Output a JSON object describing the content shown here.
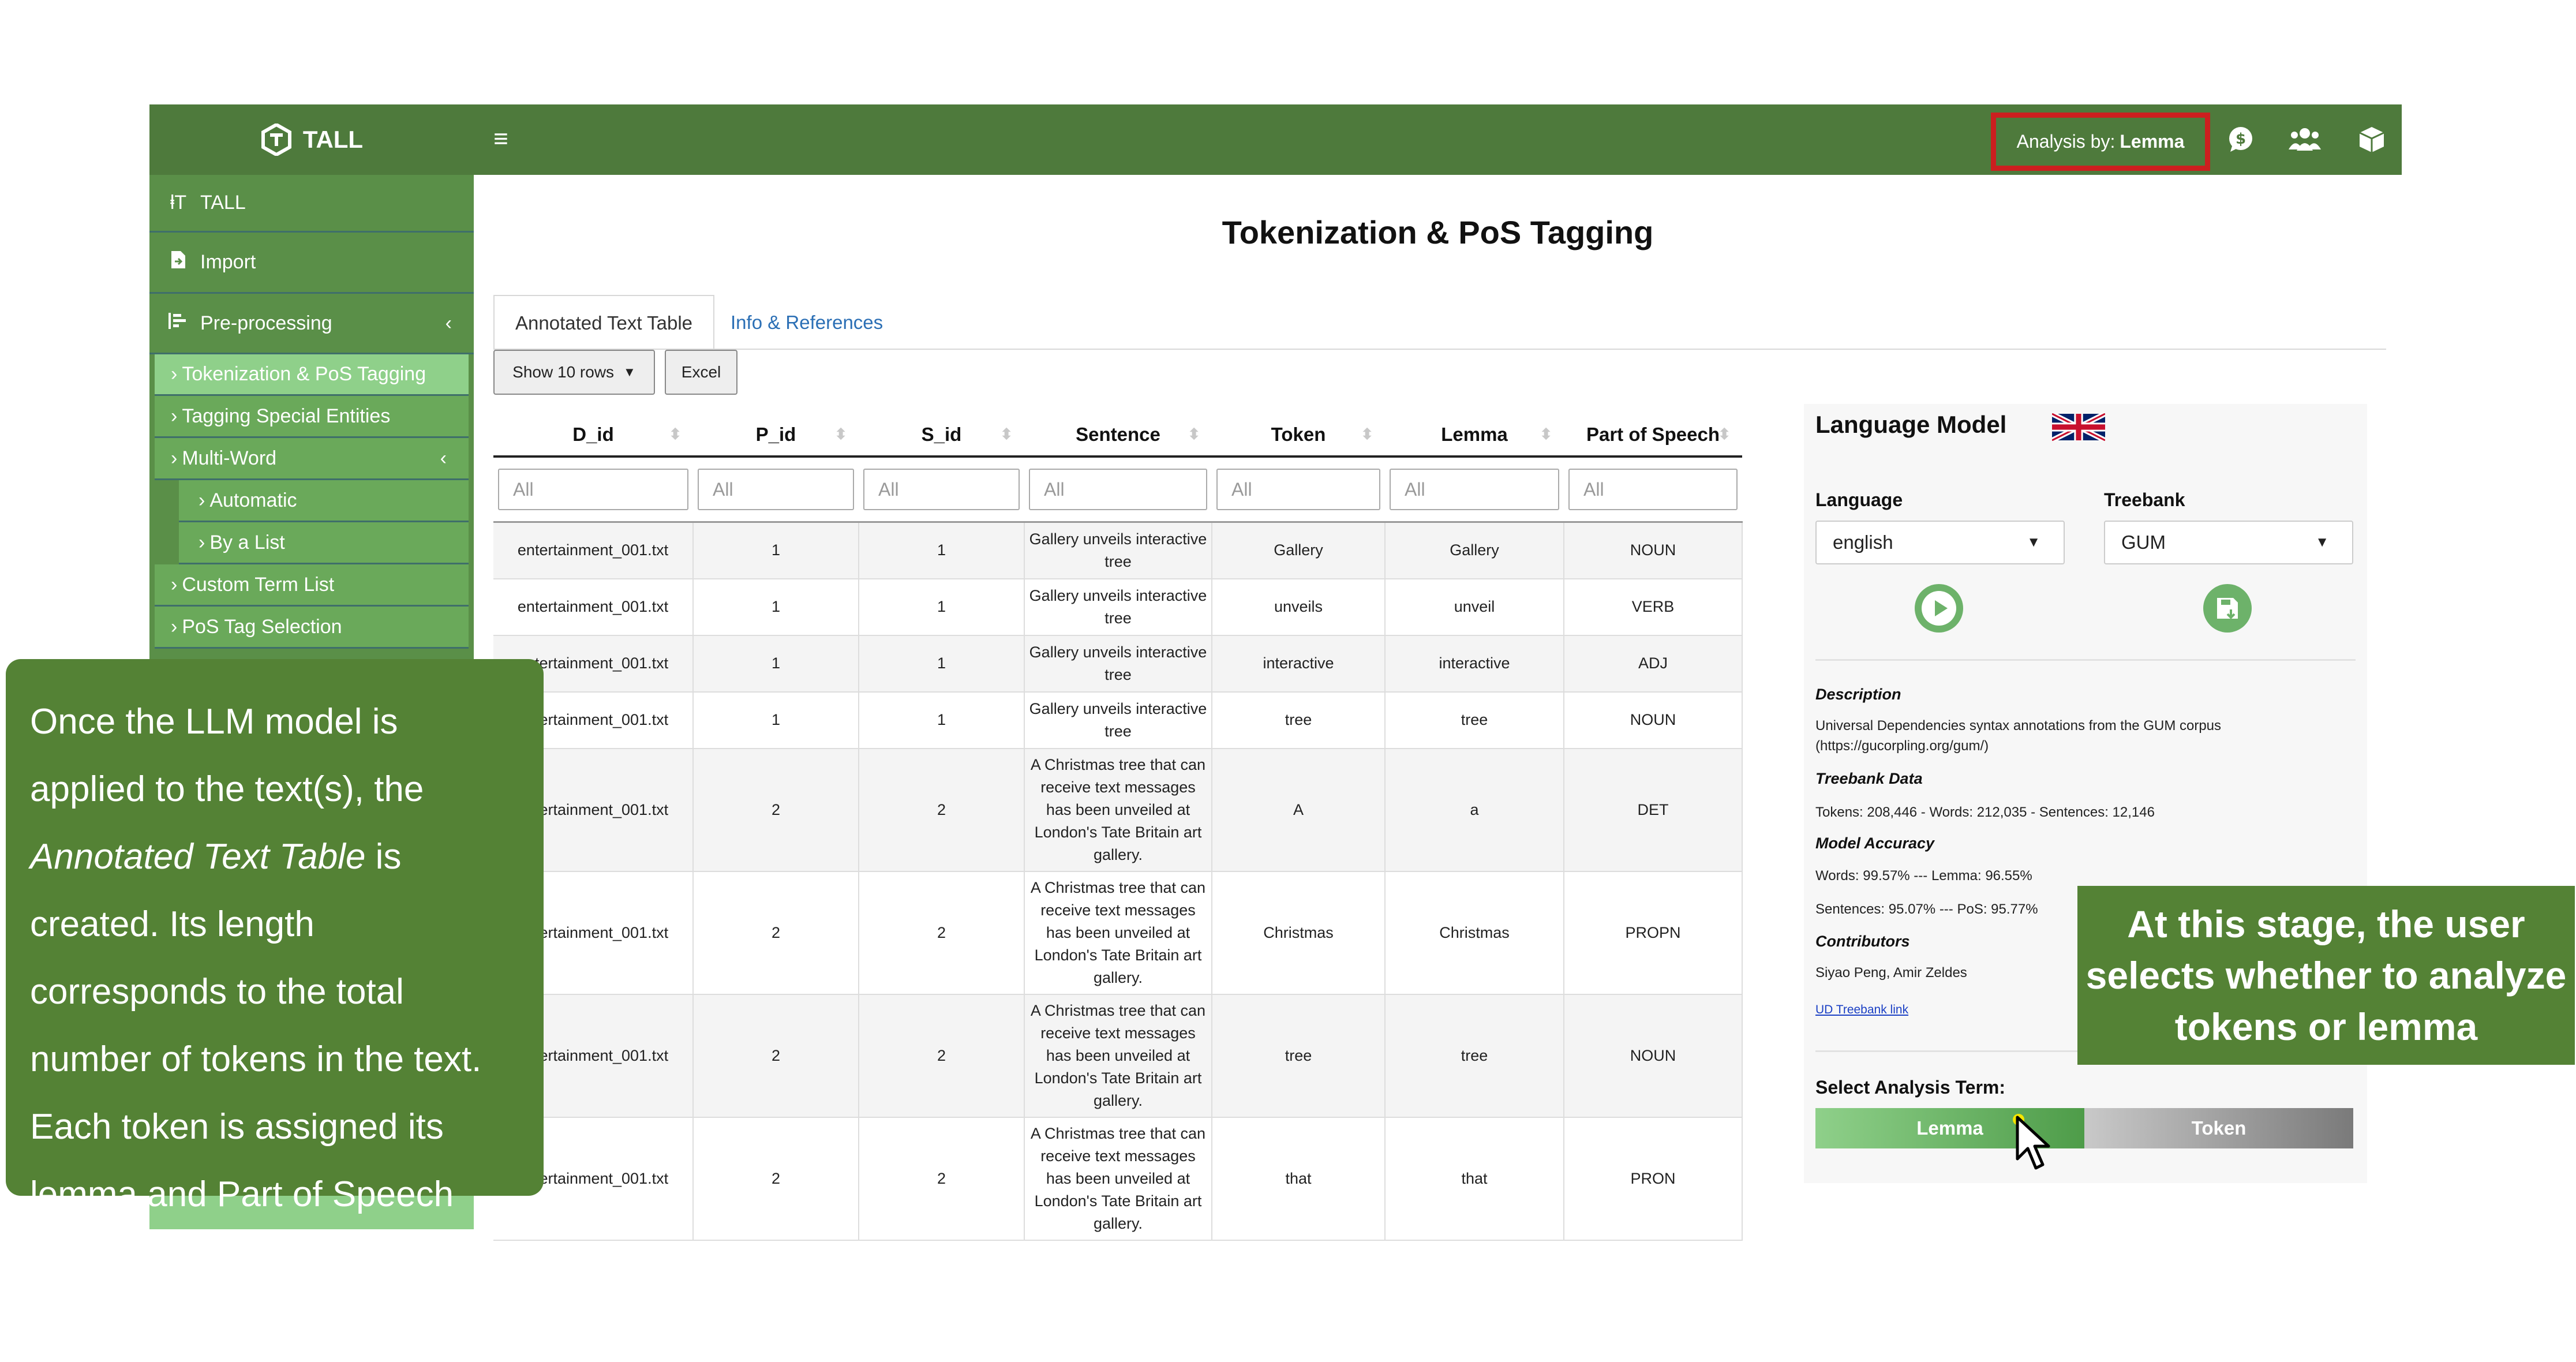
{
  "app": {
    "brand": "TALL",
    "analysis_label": "Analysis by:",
    "analysis_value": "Lemma"
  },
  "sidebar": {
    "items": [
      {
        "label": "TALL",
        "icon": "text-height-icon"
      },
      {
        "label": "Import",
        "icon": "file-import-icon"
      },
      {
        "label": "Pre-processing",
        "icon": "bars-staggered-icon"
      }
    ],
    "sub_items": [
      {
        "label": "Tokenization & PoS Tagging",
        "active": true
      },
      {
        "label": "Tagging Special Entities"
      },
      {
        "label": "Multi-Word"
      },
      {
        "label": "Automatic"
      },
      {
        "label": "By a List"
      },
      {
        "label": "Custom Term List"
      },
      {
        "label": "PoS Tag Selection"
      }
    ]
  },
  "main": {
    "title": "Tokenization & PoS Tagging",
    "tabs": [
      "Annotated Text Table",
      "Info & References"
    ],
    "show_rows": "Show 10 rows",
    "excel": "Excel",
    "filter_placeholder": "All",
    "columns": [
      "D_id",
      "P_id",
      "S_id",
      "Sentence",
      "Token",
      "Lemma",
      "Part of Speech"
    ],
    "rows": [
      [
        "entertainment_001.txt",
        "1",
        "1",
        "Gallery unveils interactive tree",
        "Gallery",
        "Gallery",
        "NOUN"
      ],
      [
        "entertainment_001.txt",
        "1",
        "1",
        "Gallery unveils interactive tree",
        "unveils",
        "unveil",
        "VERB"
      ],
      [
        "entertainment_001.txt",
        "1",
        "1",
        "Gallery unveils interactive tree",
        "interactive",
        "interactive",
        "ADJ"
      ],
      [
        "entertainment_001.txt",
        "1",
        "1",
        "Gallery unveils interactive tree",
        "tree",
        "tree",
        "NOUN"
      ],
      [
        "entertainment_001.txt",
        "2",
        "2",
        "A Christmas tree that can receive text messages has been unveiled at London's Tate Britain art gallery.",
        "A",
        "a",
        "DET"
      ],
      [
        "entertainment_001.txt",
        "2",
        "2",
        "A Christmas tree that can receive text messages has been unveiled at London's Tate Britain art gallery.",
        "Christmas",
        "Christmas",
        "PROPN"
      ],
      [
        "entertainment_001.txt",
        "2",
        "2",
        "A Christmas tree that can receive text messages has been unveiled at London's Tate Britain art gallery.",
        "tree",
        "tree",
        "NOUN"
      ],
      [
        "entertainment_001.txt",
        "2",
        "2",
        "A Christmas tree that can receive text messages has been unveiled at London's Tate Britain art gallery.",
        "that",
        "that",
        "PRON"
      ]
    ]
  },
  "language_model": {
    "title": "Language Model",
    "language_label": "Language",
    "language_value": "english",
    "treebank_label": "Treebank",
    "treebank_value": "GUM",
    "description_title": "Description",
    "description_text": "Universal Dependencies syntax annotations from the GUM corpus",
    "description_url": "(https://gucorpling.org/gum/)",
    "treebank_data_title": "Treebank Data",
    "treebank_data": "Tokens: 208,446 - Words: 212,035 - Sentences: 12,146",
    "accuracy_title": "Model Accuracy",
    "accuracy_1": "Words: 99.57% --- Lemma: 96.55%",
    "accuracy_2": "Sentences: 95.07% --- PoS: 95.77%",
    "contributors_title": "Contributors",
    "contributors": "Siyao Peng, Amir Zeldes",
    "link": "UD Treebank link",
    "select_term_label": "Select Analysis Term:",
    "lemma_label": "Lemma",
    "token_label": "Token"
  },
  "callouts": {
    "left_1": "Once the LLM model is applied to the text(s), the ",
    "left_em": "Annotated Text Table",
    "left_2": " is created. Its length corresponds to the total number of tokens in the text. Each token is assigned its lemma and Part of Speech",
    "right": "At this stage, the user selects whether to analyze tokens or lemma"
  },
  "colors": {
    "header_green": "#4e7a3c",
    "callout_green": "#548235",
    "highlight_red": "#cc1f1f"
  }
}
